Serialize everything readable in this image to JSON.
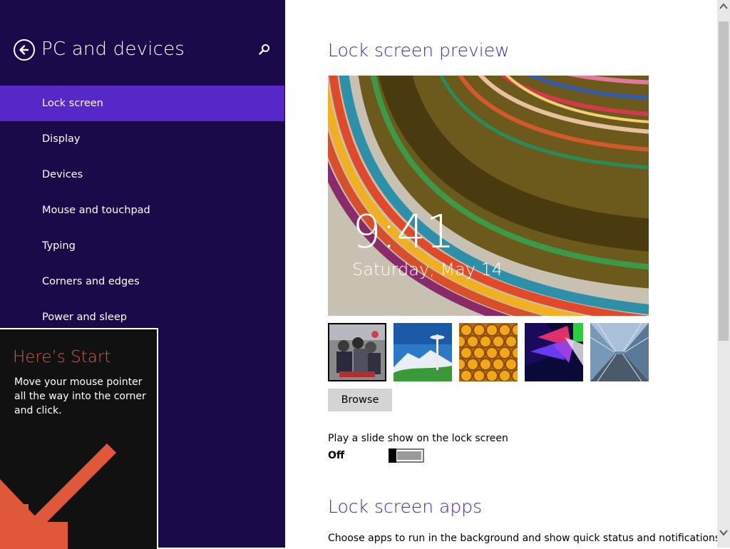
{
  "sidebar": {
    "title": "PC and devices",
    "back_icon": "back-arrow-circle-icon",
    "search_icon": "search-icon",
    "items": [
      {
        "label": "Lock screen",
        "selected": true
      },
      {
        "label": "Display",
        "selected": false
      },
      {
        "label": "Devices",
        "selected": false
      },
      {
        "label": "Mouse and touchpad",
        "selected": false
      },
      {
        "label": "Typing",
        "selected": false
      },
      {
        "label": "Corners and edges",
        "selected": false
      },
      {
        "label": "Power and sleep",
        "selected": false
      }
    ],
    "background_color": "#1b0a4a",
    "selected_color": "#5628c8"
  },
  "start_tip": {
    "title": "Here’s Start",
    "body": "Move your mouse pointer all the way into the corner and click.",
    "arrow_icon": "arrow-down-left-icon",
    "accent_color": "#e0583a"
  },
  "main": {
    "preview_title": "Lock screen preview",
    "preview": {
      "time": "9:41",
      "date": "Saturday, May 14"
    },
    "thumbnails": [
      {
        "name": "crowd-photo",
        "selected": true
      },
      {
        "name": "space-needle",
        "selected": false
      },
      {
        "name": "honeycomb",
        "selected": false
      },
      {
        "name": "color-shapes",
        "selected": false
      },
      {
        "name": "subway-tunnel",
        "selected": false
      }
    ],
    "browse_label": "Browse",
    "slideshow": {
      "label": "Play a slide show on the lock screen",
      "state": "Off",
      "on": false
    },
    "apps_title": "Lock screen apps",
    "apps_description": "Choose apps to run in the background and show quick status and notifications,",
    "title_color": "#4a2a9c"
  },
  "scrollbar": {
    "up_icon": "scroll-up-arrow-icon",
    "down_icon": "scroll-down-arrow-icon"
  }
}
